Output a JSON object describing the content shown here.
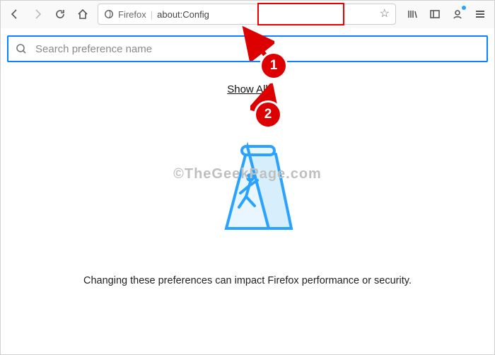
{
  "toolbar": {
    "identity_label": "Firefox",
    "url_text": "about:Config"
  },
  "search": {
    "placeholder": "Search preference name"
  },
  "main": {
    "show_all": "Show All",
    "warning_text": "Changing these preferences can impact Firefox performance or security."
  },
  "watermark": "©TheGeekPage.com",
  "annotations": {
    "badge1": "1",
    "badge2": "2"
  }
}
